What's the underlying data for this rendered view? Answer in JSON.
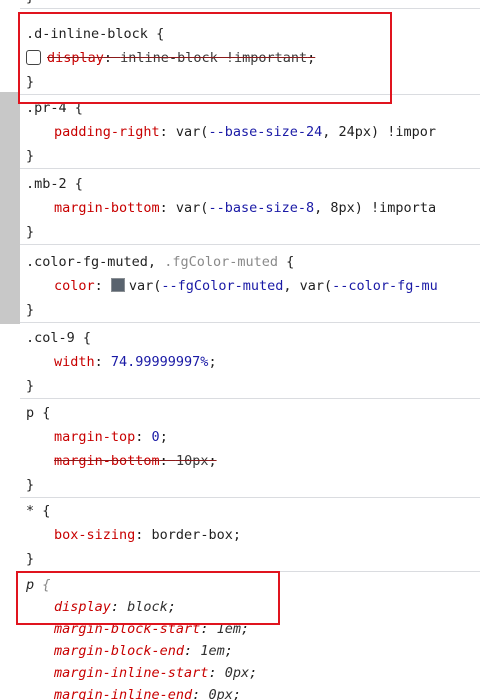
{
  "rules": [
    {
      "selector": ".d-inline-block",
      "open": "{",
      "close": "}",
      "declarations": [
        {
          "name": "display",
          "value": "inline-block !important",
          "struck": true
        }
      ]
    },
    {
      "selector": ".pr-4",
      "open": "{",
      "close": "}",
      "declarations": [
        {
          "name": "padding-right",
          "var": "--base-size-24",
          "fallback": "24px",
          "suffix": "!impor"
        }
      ]
    },
    {
      "selector": ".mb-2",
      "open": "{",
      "close": "}",
      "declarations": [
        {
          "name": "margin-bottom",
          "var": "--base-size-8",
          "fallback": "8px",
          "suffix": "!importa"
        }
      ]
    },
    {
      "selector": ".color-fg-muted",
      "selector_dim": ".fgColor-muted",
      "open": "{",
      "close": "}",
      "declarations": [
        {
          "name": "color",
          "var": "--fgColor-muted",
          "fallback_var": "--color-fg-mu",
          "swatch": "#59636e"
        }
      ]
    },
    {
      "selector": ".col-9",
      "open": "{",
      "close": "}",
      "declarations": [
        {
          "name": "width",
          "value": "74.99999997%"
        }
      ]
    },
    {
      "selector": "p",
      "open": "{",
      "close": "}",
      "declarations": [
        {
          "name": "margin-top",
          "value": "0"
        },
        {
          "name": "margin-bottom",
          "value": "10px",
          "struck": true
        }
      ]
    },
    {
      "selector": "*",
      "open": "{",
      "close": "}",
      "declarations": [
        {
          "name": "box-sizing",
          "value": "border-box"
        }
      ]
    },
    {
      "selector": "p",
      "open": "{",
      "user_agent": true,
      "declarations": [
        {
          "name": "display",
          "value": "block"
        },
        {
          "name": "margin-block-start",
          "value": "1em"
        },
        {
          "name": "margin-block-end",
          "value": "1em"
        },
        {
          "name": "margin-inline-start",
          "value": "0px"
        },
        {
          "name": "margin-inline-end",
          "value": "0px"
        }
      ]
    }
  ]
}
